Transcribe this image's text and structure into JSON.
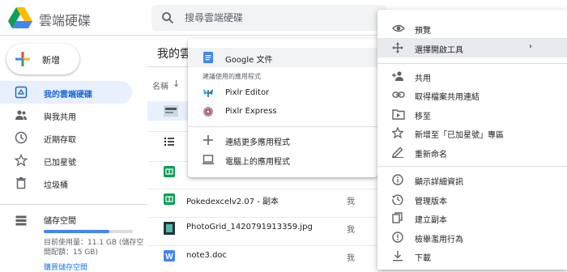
{
  "app": {
    "title": "雲端硬碟",
    "logo_icon": "google-drive-logo"
  },
  "search": {
    "placeholder": "搜尋雲端硬碟",
    "icon": "search-icon"
  },
  "sidebar": {
    "new_button": "新增",
    "items": [
      {
        "label": "我的雲端硬碟",
        "icon": "my-drive-icon",
        "active": true
      },
      {
        "label": "與我共用",
        "icon": "people-icon"
      },
      {
        "label": "近期存取",
        "icon": "clock-icon"
      },
      {
        "label": "已加星號",
        "icon": "star-icon"
      },
      {
        "label": "垃圾桶",
        "icon": "trash-icon"
      }
    ],
    "storage": {
      "label": "儲存空間",
      "usage_text": "目前使用量：11.1 GB (儲存空間配額：15 GB)",
      "used_fraction": 0.74,
      "buy_link": "購買儲存空間"
    }
  },
  "main": {
    "title": "我的雲",
    "column_name": "名稱",
    "files": [
      {
        "name": "",
        "icon": "image-thumb-icon",
        "owner": "",
        "selected": true
      },
      {
        "name": "",
        "icon": "list-icon",
        "owner": ""
      },
      {
        "name": "",
        "icon": "sheets-icon",
        "owner": ""
      },
      {
        "name": "Pokedexcelv2.07 - 副本",
        "icon": "sheets-icon",
        "owner": "我"
      },
      {
        "name": "PhotoGrid_1420791913359.jpg",
        "icon": "image-thumb-icon",
        "owner": "我"
      },
      {
        "name": "note3.doc",
        "icon": "word-doc-icon",
        "owner": "我"
      }
    ]
  },
  "open_with_menu": {
    "primary": "Google 文件",
    "suggested_header": "建議使用的應用程式",
    "apps": [
      "Pixlr Editor",
      "Pixlr Express"
    ],
    "more": [
      "連結更多應用程式",
      "電腦上的應用程式"
    ]
  },
  "context_menu": {
    "items": [
      {
        "label": "預覽",
        "icon": "eye-icon"
      },
      {
        "label": "選擇開啟工具",
        "icon": "move-arrows-icon",
        "submenu": true,
        "highlighted": true
      },
      {
        "label": "共用",
        "icon": "person-add-icon"
      },
      {
        "label": "取得檔案共用連結",
        "icon": "link-icon"
      },
      {
        "label": "移至",
        "icon": "folder-move-icon"
      },
      {
        "label": "新增至「已加星號」專區",
        "icon": "star-icon"
      },
      {
        "label": "重新命名",
        "icon": "pencil-icon"
      },
      {
        "label": "顯示詳細資訊",
        "icon": "info-icon"
      },
      {
        "label": "管理版本",
        "icon": "history-icon"
      },
      {
        "label": "建立副本",
        "icon": "copy-icon"
      },
      {
        "label": "檢舉濫用行為",
        "icon": "report-icon"
      },
      {
        "label": "下載",
        "icon": "download-icon"
      }
    ]
  },
  "colors": {
    "accent": "#1a73e8",
    "active_bg": "#e8f0fe",
    "sheets_green": "#0f9d58",
    "docs_blue": "#4285f4"
  }
}
